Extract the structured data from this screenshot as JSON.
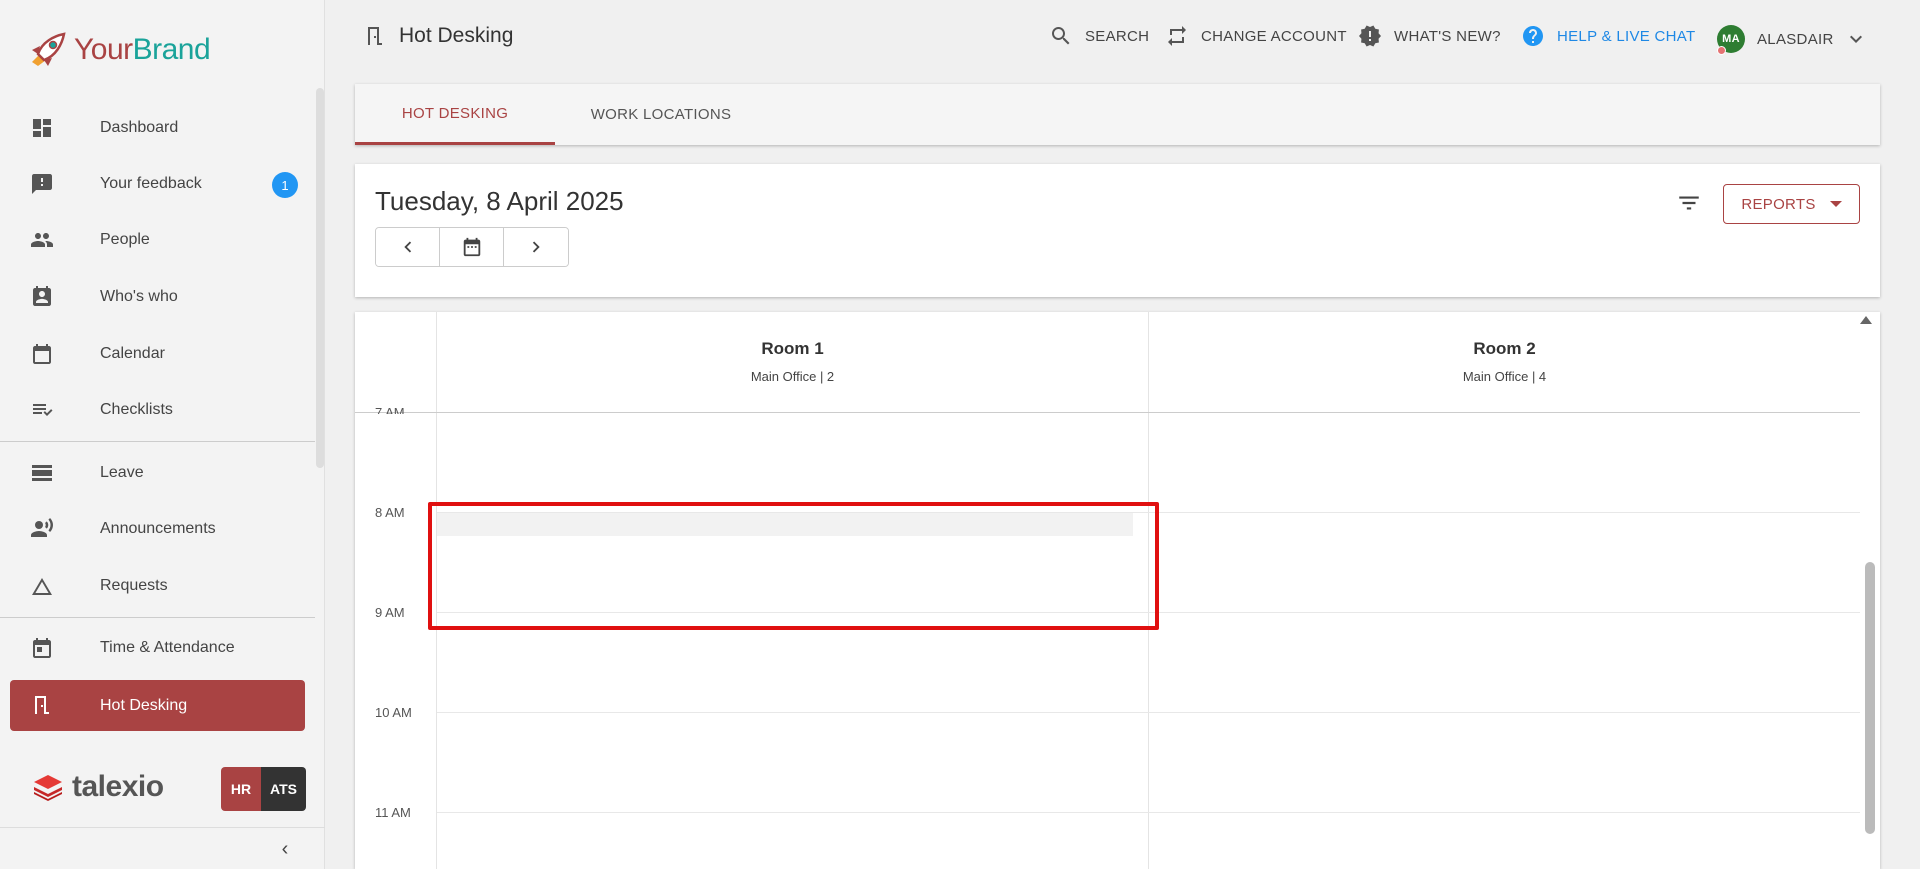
{
  "brand": {
    "name_part1": "Your",
    "name_part2": "Brand"
  },
  "sidebar": {
    "items": [
      {
        "label": "Dashboard",
        "icon": "dashboard-icon"
      },
      {
        "label": "Your feedback",
        "icon": "feedback-icon",
        "badge": "1"
      },
      {
        "label": "People",
        "icon": "people-icon"
      },
      {
        "label": "Who's who",
        "icon": "contact-card-icon"
      },
      {
        "label": "Calendar",
        "icon": "calendar-icon"
      },
      {
        "label": "Checklists",
        "icon": "checklist-icon"
      },
      {
        "label": "Leave",
        "icon": "leave-icon"
      },
      {
        "label": "Announcements",
        "icon": "announcement-icon"
      },
      {
        "label": "Requests",
        "icon": "triangle-icon"
      },
      {
        "label": "Time & Attendance",
        "icon": "time-attendance-icon"
      },
      {
        "label": "Hot Desking",
        "icon": "door-icon",
        "active": true
      }
    ],
    "footer": {
      "product": "talexio",
      "hr_label": "HR",
      "ats_label": "ATS"
    }
  },
  "topbar": {
    "title": "Hot Desking",
    "search_label": "SEARCH",
    "change_account_label": "CHANGE ACCOUNT",
    "whats_new_label": "WHAT'S NEW?",
    "help_label": "HELP & LIVE CHAT",
    "user_initials": "MA",
    "user_name": "ALASDAIR"
  },
  "tabs": [
    {
      "label": "HOT DESKING",
      "active": true
    },
    {
      "label": "WORK LOCATIONS",
      "active": false
    }
  ],
  "date_panel": {
    "date": "Tuesday, 8 April 2025",
    "reports_label": "REPORTS"
  },
  "calendar": {
    "rooms": [
      {
        "name": "Room 1",
        "subtitle": "Main Office | 2"
      },
      {
        "name": "Room 2",
        "subtitle": "Main Office | 4"
      }
    ],
    "hours": [
      "7 AM",
      "8 AM",
      "9 AM",
      "10 AM",
      "11 AM"
    ]
  },
  "colors": {
    "brand": "#a94343",
    "accent_teal": "#1aa39a",
    "link_blue": "#1e88e5",
    "highlight": "#e01010"
  }
}
